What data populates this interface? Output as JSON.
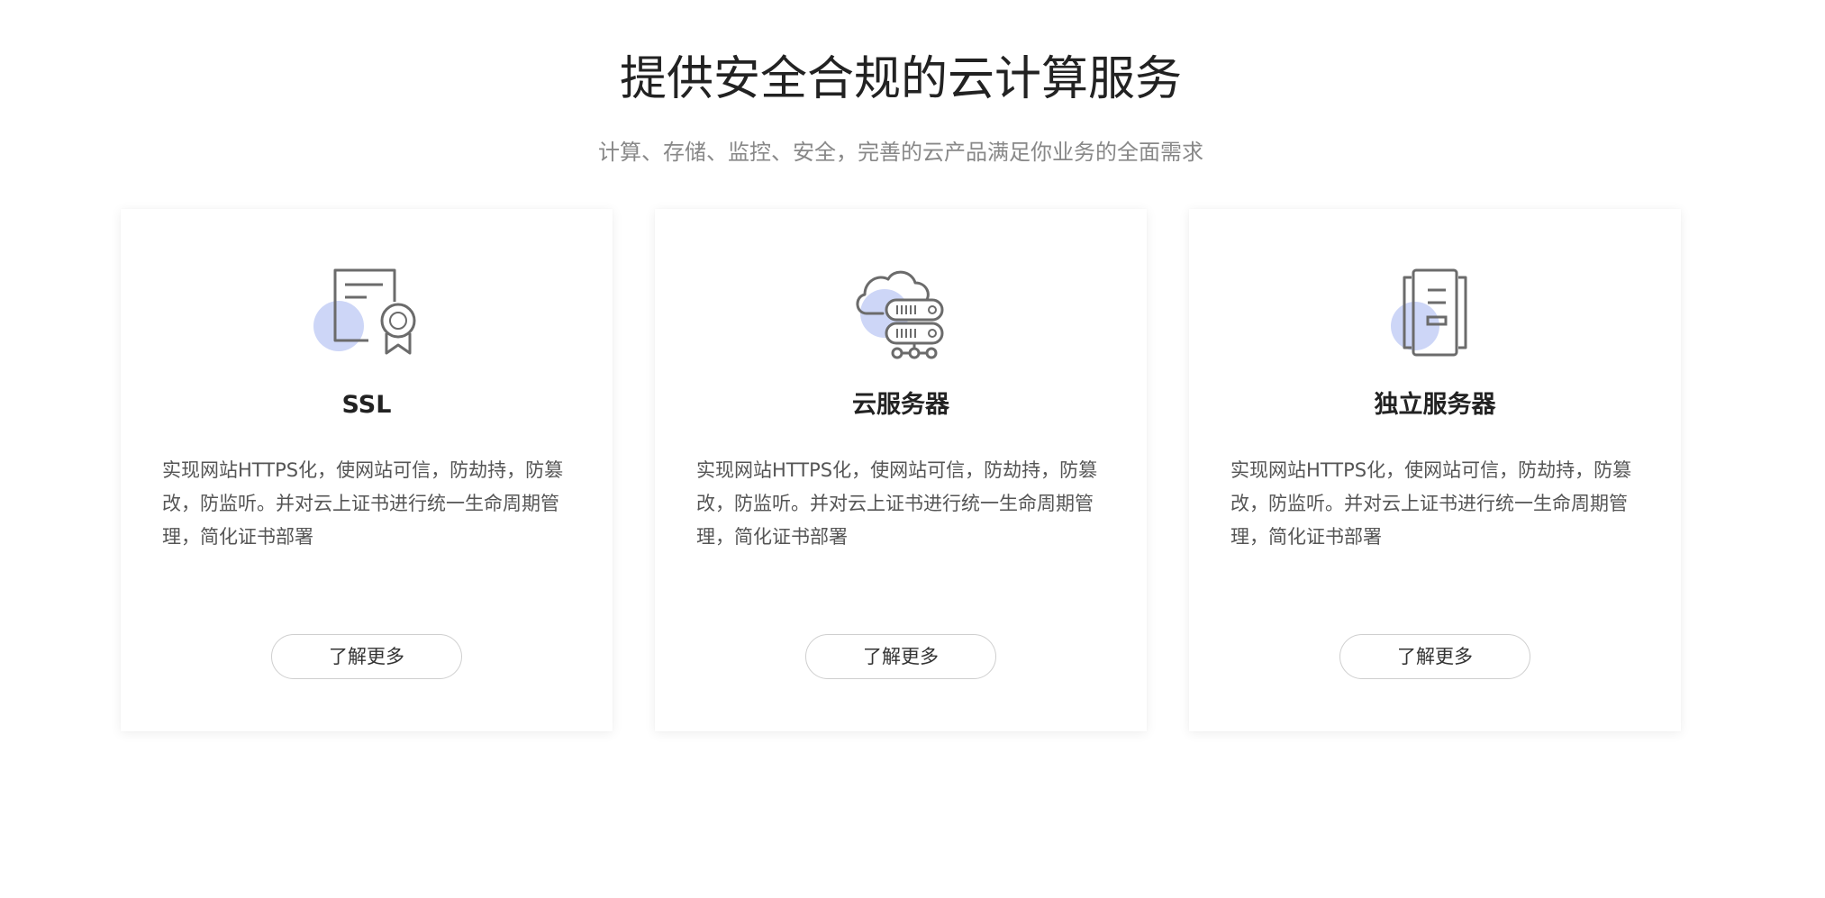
{
  "header": {
    "title": "提供安全合规的云计算服务",
    "subtitle": "计算、存储、监控、安全，完善的云产品满足你业务的全面需求"
  },
  "colors": {
    "accent_circle": "#cdd6f7",
    "icon_stroke": "#6b6b6b",
    "title_text": "#222222",
    "desc_text": "#555555",
    "button_border": "#cfcfcf"
  },
  "cards": [
    {
      "icon": "certificate-icon",
      "title": "SSL",
      "description": "实现网站HTTPS化，使网站可信，防劫持，防篡改，防监听。并对云上证书进行统一生命周期管理，简化证书部署",
      "button_label": "了解更多"
    },
    {
      "icon": "cloud-server-icon",
      "title": "云服务器",
      "description": "实现网站HTTPS化，使网站可信，防劫持，防篡改，防监听。并对云上证书进行统一生命周期管理，简化证书部署",
      "button_label": "了解更多"
    },
    {
      "icon": "dedicated-server-icon",
      "title": "独立服务器",
      "description": "实现网站HTTPS化，使网站可信，防劫持，防篡改，防监听。并对云上证书进行统一生命周期管理，简化证书部署",
      "button_label": "了解更多"
    }
  ]
}
